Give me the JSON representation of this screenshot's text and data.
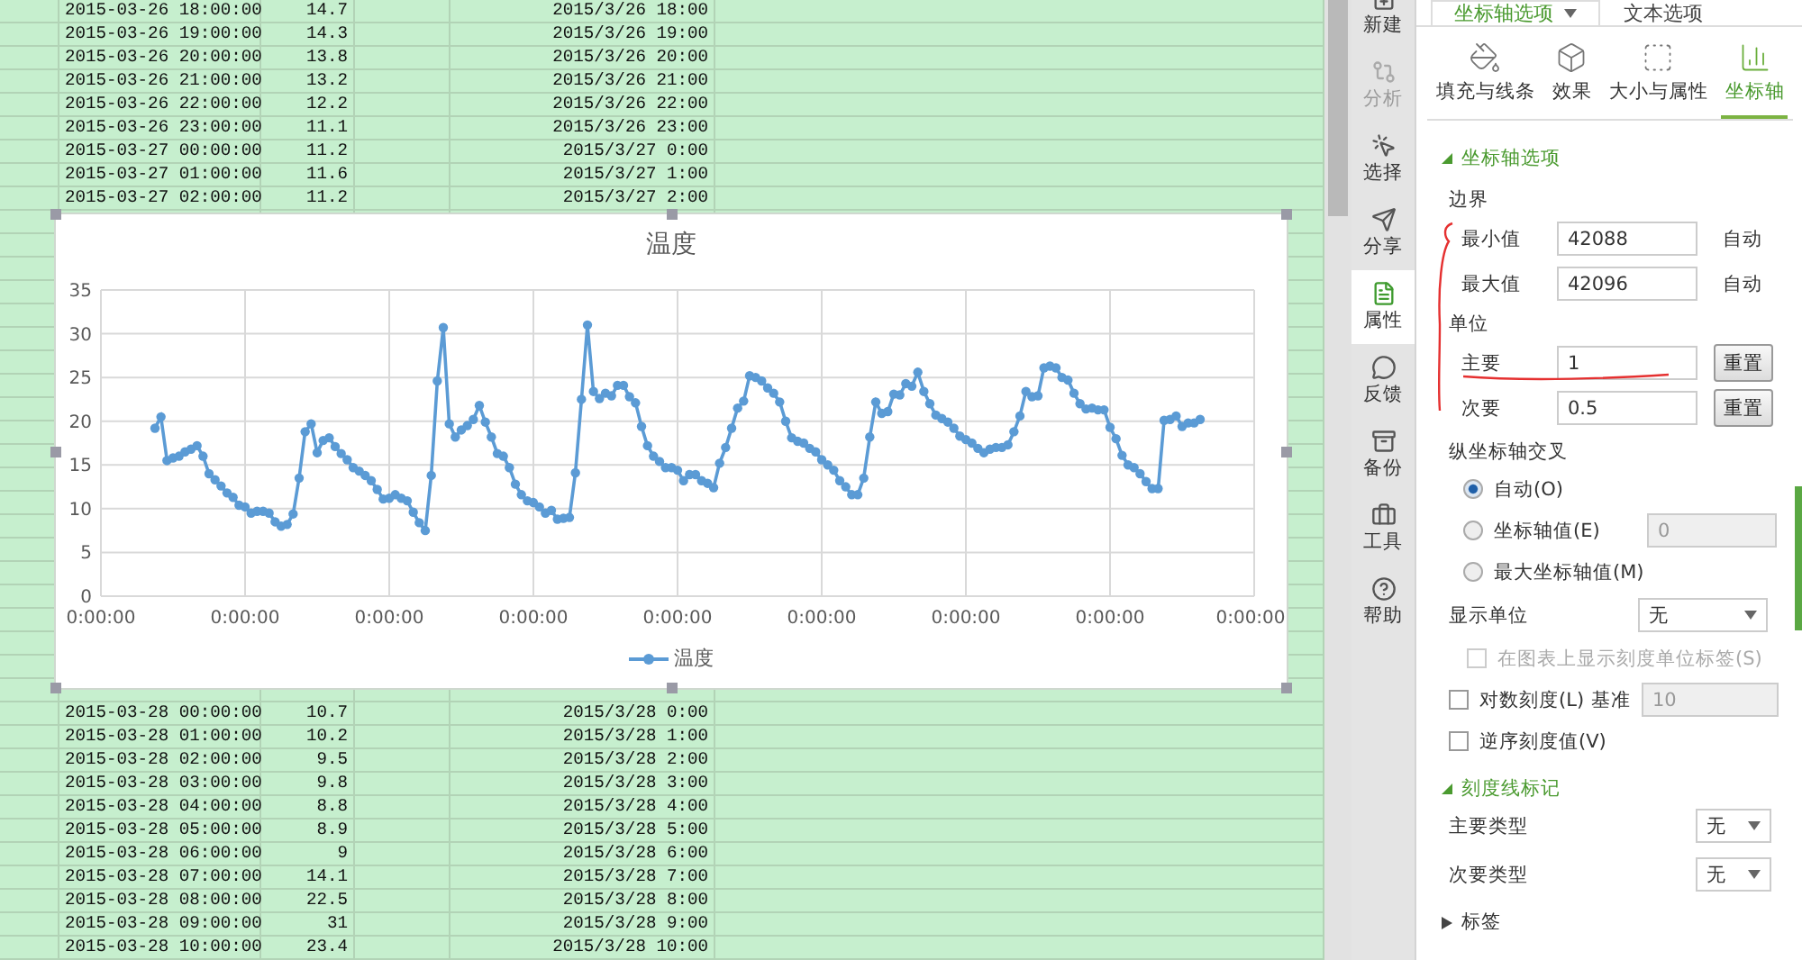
{
  "spreadsheet": {
    "rows_top": [
      {
        "datetime": "2015-03-26 18:00:00",
        "value": "14.7",
        "date": "2015/3/26 18:00"
      },
      {
        "datetime": "2015-03-26 19:00:00",
        "value": "14.3",
        "date": "2015/3/26 19:00"
      },
      {
        "datetime": "2015-03-26 20:00:00",
        "value": "13.8",
        "date": "2015/3/26 20:00"
      },
      {
        "datetime": "2015-03-26 21:00:00",
        "value": "13.2",
        "date": "2015/3/26 21:00"
      },
      {
        "datetime": "2015-03-26 22:00:00",
        "value": "12.2",
        "date": "2015/3/26 22:00"
      },
      {
        "datetime": "2015-03-26 23:00:00",
        "value": "11.1",
        "date": "2015/3/26 23:00"
      },
      {
        "datetime": "2015-03-27 00:00:00",
        "value": "11.2",
        "date": "2015/3/27 0:00"
      },
      {
        "datetime": "2015-03-27 01:00:00",
        "value": "11.6",
        "date": "2015/3/27 1:00"
      },
      {
        "datetime": "2015-03-27 02:00:00",
        "value": "11.2",
        "date": "2015/3/27 2:00"
      }
    ],
    "rows_bottom": [
      {
        "datetime": "2015-03-28 00:00:00",
        "value": "10.7",
        "date": "2015/3/28 0:00"
      },
      {
        "datetime": "2015-03-28 01:00:00",
        "value": "10.2",
        "date": "2015/3/28 1:00"
      },
      {
        "datetime": "2015-03-28 02:00:00",
        "value": "9.5",
        "date": "2015/3/28 2:00"
      },
      {
        "datetime": "2015-03-28 03:00:00",
        "value": "9.8",
        "date": "2015/3/28 3:00"
      },
      {
        "datetime": "2015-03-28 04:00:00",
        "value": "8.8",
        "date": "2015/3/28 4:00"
      },
      {
        "datetime": "2015-03-28 05:00:00",
        "value": "8.9",
        "date": "2015/3/28 5:00"
      },
      {
        "datetime": "2015-03-28 06:00:00",
        "value": "9",
        "date": "2015/3/28 6:00"
      },
      {
        "datetime": "2015-03-28 07:00:00",
        "value": "14.1",
        "date": "2015/3/28 7:00"
      },
      {
        "datetime": "2015-03-28 08:00:00",
        "value": "22.5",
        "date": "2015/3/28 8:00"
      },
      {
        "datetime": "2015-03-28 09:00:00",
        "value": "31",
        "date": "2015/3/28 9:00"
      },
      {
        "datetime": "2015-03-28 10:00:00",
        "value": "23.4",
        "date": "2015/3/28 10:00"
      }
    ]
  },
  "chart": {
    "chart_data": {
      "type": "line",
      "title": "温度",
      "grid": true,
      "ylim": [
        0,
        35
      ],
      "yticks": [
        0,
        5,
        10,
        15,
        20,
        25,
        30,
        35
      ],
      "categories": [
        "0:00:00",
        null,
        null,
        null,
        null,
        null,
        null,
        null,
        null,
        null,
        null,
        null,
        null,
        null,
        null,
        null,
        null,
        null,
        null,
        null,
        null,
        null,
        null,
        null,
        "0:00:00",
        null,
        null,
        null,
        null,
        null,
        null,
        null,
        null,
        null,
        null,
        null,
        null,
        null,
        null,
        null,
        null,
        null,
        null,
        null,
        null,
        null,
        null,
        null,
        "0:00:00",
        null,
        null,
        null,
        null,
        null,
        null,
        null,
        null,
        null,
        null,
        null,
        null,
        null,
        null,
        null,
        null,
        null,
        null,
        null,
        null,
        null,
        null,
        null,
        "0:00:00",
        null,
        null,
        null,
        null,
        null,
        null,
        null,
        null,
        null,
        null,
        null,
        null,
        null,
        null,
        null,
        null,
        null,
        null,
        null,
        null,
        null,
        null,
        null,
        "0:00:00",
        null,
        null,
        null,
        null,
        null,
        null,
        null,
        null,
        null,
        null,
        null,
        null,
        null,
        null,
        null,
        null,
        null,
        null,
        null,
        null,
        null,
        null,
        null,
        "0:00:00",
        null,
        null,
        null,
        null,
        null,
        null,
        null,
        null,
        null,
        null,
        null,
        null,
        null,
        null,
        null,
        null,
        null,
        null,
        null,
        null,
        null,
        null,
        null,
        "0:00:00",
        null,
        null,
        null,
        null,
        null,
        null,
        null,
        null,
        null,
        null,
        null,
        null,
        null,
        null,
        null,
        null,
        null,
        null,
        null,
        null,
        null,
        null,
        null,
        "0:00:00",
        null,
        null,
        null,
        null,
        null,
        null,
        null,
        null,
        null,
        null,
        null,
        null,
        null,
        null,
        null,
        null,
        null,
        null,
        null,
        null,
        null,
        null,
        null,
        "0:00:00"
      ],
      "series": [
        {
          "name": "温度",
          "color": "#5b9bd5",
          "marker": "circle",
          "values": [
            null,
            null,
            null,
            null,
            null,
            null,
            null,
            null,
            null,
            19.2,
            20.5,
            15.5,
            15.8,
            16,
            16.5,
            16.8,
            17.2,
            16,
            14,
            13.3,
            12.6,
            11.8,
            11.3,
            10.4,
            10.2,
            9.5,
            9.7,
            9.7,
            9.5,
            8.5,
            8,
            8.2,
            9.4,
            13.5,
            18.8,
            19.7,
            16.4,
            17.8,
            18.1,
            17.1,
            16.3,
            15.6,
            14.7,
            14.3,
            13.8,
            13.2,
            12.2,
            11.1,
            11.2,
            11.6,
            11.2,
            10.9,
            9.6,
            8.4,
            7.5,
            13.8,
            24.6,
            30.7,
            19.7,
            18.2,
            19,
            19.5,
            20.2,
            21.8,
            19.9,
            18.2,
            16.3,
            16,
            14.7,
            12.8,
            11.6,
            10.9,
            10.7,
            10.2,
            9.5,
            9.8,
            8.8,
            8.9,
            9,
            14.1,
            22.5,
            31,
            23.4,
            22.6,
            23.2,
            22.9,
            24.1,
            24.1,
            22.8,
            22.1,
            19.4,
            17.2,
            16,
            15.4,
            14.7,
            14.7,
            14.4,
            13.2,
            13.9,
            13.9,
            13.2,
            12.9,
            12.4,
            15.2,
            17,
            19.2,
            21.5,
            22.3,
            25.2,
            25,
            24.6,
            23.8,
            23.2,
            22.2,
            20,
            18.1,
            17.7,
            17.5,
            16.9,
            16.5,
            15.6,
            15,
            14.4,
            13.2,
            12.5,
            11.6,
            11.6,
            13.5,
            18.2,
            22.2,
            20.9,
            21.1,
            23.1,
            23,
            24.3,
            24,
            25.6,
            23.4,
            22,
            20.7,
            20.3,
            19.9,
            19.2,
            18.3,
            17.9,
            17.5,
            16.9,
            16.4,
            16.8,
            17,
            17,
            17.3,
            18.8,
            20.6,
            23.4,
            22.8,
            22.9,
            26.1,
            26.3,
            26.1,
            25,
            24.7,
            23.2,
            22,
            21.4,
            21.5,
            21.3,
            21.3,
            19.3,
            18,
            16.1,
            15,
            14.7,
            14,
            13.1,
            12.3,
            12.3,
            20.1,
            20.2,
            20.6,
            19.4,
            19.8,
            19.8,
            20.2,
            null,
            null,
            null,
            null,
            null,
            null,
            null,
            null,
            null
          ]
        }
      ]
    }
  },
  "nav": [
    {
      "label": "新建",
      "selected": false,
      "disabled": false
    },
    {
      "label": "分析",
      "selected": false,
      "disabled": true
    },
    {
      "label": "选择",
      "selected": false,
      "disabled": false
    },
    {
      "label": "分享",
      "selected": false,
      "disabled": false
    },
    {
      "label": "属性",
      "selected": true,
      "disabled": false
    },
    {
      "label": "反馈",
      "selected": false,
      "disabled": false
    },
    {
      "label": "备份",
      "selected": false,
      "disabled": false
    },
    {
      "label": "工具",
      "selected": false,
      "disabled": false
    },
    {
      "label": "帮助",
      "selected": false,
      "disabled": false
    }
  ],
  "panel": {
    "tabs": [
      {
        "label": "坐标轴选项",
        "selected": true
      },
      {
        "label": "文本选项",
        "selected": false
      }
    ],
    "category_tabs": [
      {
        "label": "填充与线条",
        "selected": false
      },
      {
        "label": "效果",
        "selected": false
      },
      {
        "label": "大小与属性",
        "selected": false
      },
      {
        "label": "坐标轴",
        "selected": true
      }
    ],
    "axis_options": {
      "title": "坐标轴选项",
      "expanded": true,
      "bounds_label": "边界",
      "bounds": [
        {
          "label": "最小值",
          "value": "42088",
          "status": "自动"
        },
        {
          "label": "最大值",
          "value": "42096",
          "status": "自动"
        }
      ],
      "units_label": "单位",
      "units": [
        {
          "label": "主要",
          "value": "1",
          "button": "重置"
        },
        {
          "label": "次要",
          "value": "0.5",
          "button": "重置"
        }
      ],
      "cross_label": "纵坐标轴交叉",
      "cross_options": [
        {
          "label": "自动(O)",
          "selected": true
        },
        {
          "label": "坐标轴值(E)",
          "selected": false,
          "field": {
            "value": "0",
            "disabled": true
          }
        },
        {
          "label": "最大坐标轴值(M)",
          "selected": false
        }
      ],
      "display_unit": {
        "label": "显示单位",
        "value": "无"
      },
      "checks": [
        {
          "label": "在图表上显示刻度单位标签(S)",
          "checked": false,
          "disabled": true
        },
        {
          "label": "对数刻度(L)",
          "checked": false,
          "disabled": false,
          "base_label": "基准",
          "field": {
            "value": "10",
            "disabled": true
          }
        },
        {
          "label": "逆序刻度值(V)",
          "checked": false,
          "disabled": false
        }
      ]
    },
    "tick_marks": {
      "title": "刻度线标记",
      "expanded": true,
      "types": [
        {
          "label": "主要类型",
          "value": "无"
        },
        {
          "label": "次要类型",
          "value": "无"
        }
      ]
    },
    "labels_section": {
      "title": "标签",
      "expanded": false
    }
  }
}
